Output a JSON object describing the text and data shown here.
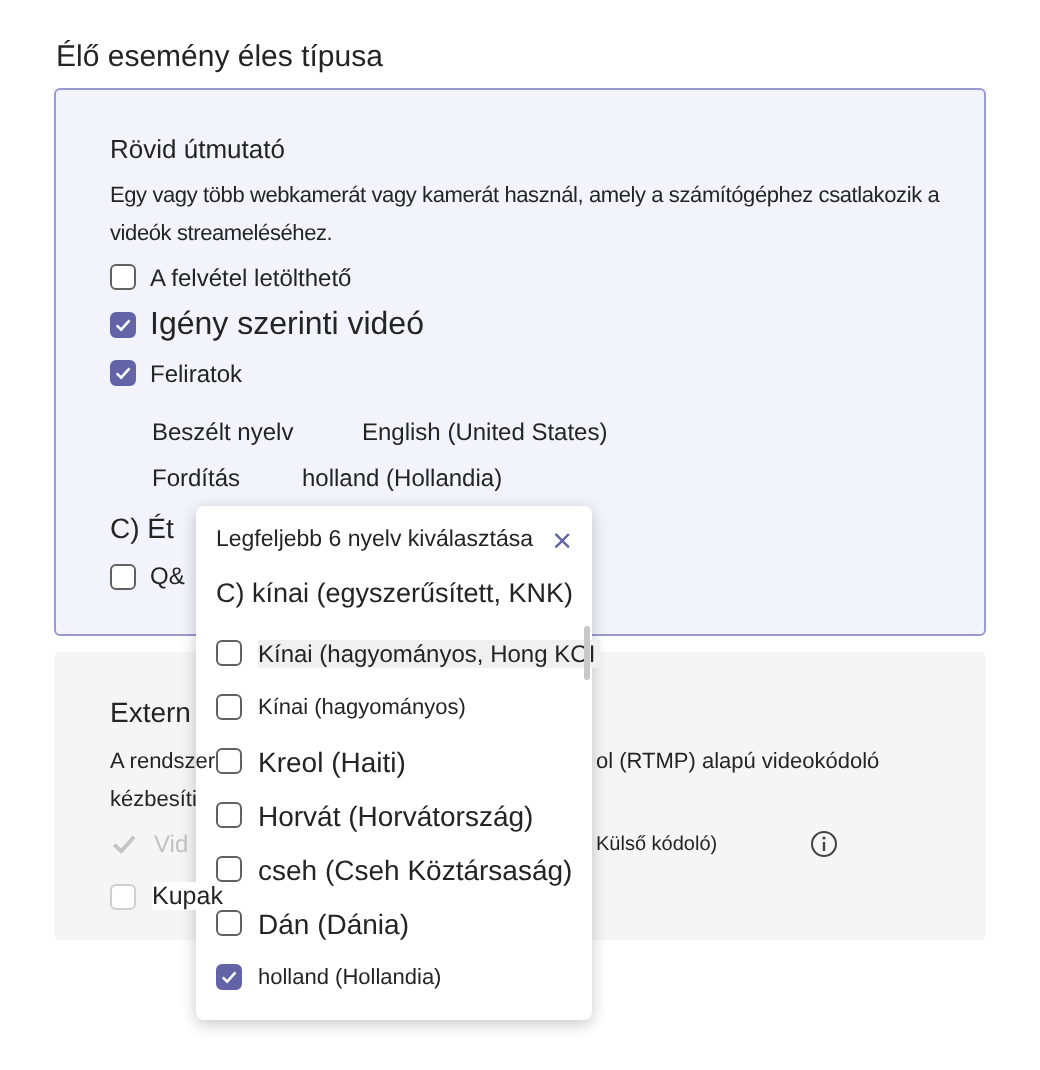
{
  "title": "Élő esemény éles típusa",
  "quick_guide": {
    "heading": "Rövid útmutató",
    "description": "Egy vagy több webkamerát vagy kamerát használ, amely a számítógéphez csatlakozik a videók streameléséhez.",
    "options": [
      {
        "label": "A felvétel letölthető",
        "checked": false
      },
      {
        "label": "Igény szerinti videó",
        "checked": true
      },
      {
        "label": "Feliratok",
        "checked": true
      }
    ],
    "settings": [
      {
        "label": "Beszélt nyelv",
        "value": "English (United States)"
      },
      {
        "label": "Fordítás",
        "value": "holland (Hollandia)"
      }
    ],
    "section_label": "C) Ét",
    "qa": {
      "label": "Q&",
      "checked": false
    }
  },
  "external": {
    "heading": "Extern",
    "description_left": "A rendszer",
    "description_right": "ol (RTMP) alapú videokódoló",
    "description_line2": "kézbesíti",
    "video_label": "Vid",
    "video_right": "Külső kódoló)",
    "captions": {
      "label": "Kupak",
      "checked": false
    }
  },
  "language_popup": {
    "title": "Legfeljebb 6 nyelv kiválasztása",
    "close": "×",
    "top_item": "C) kínai (egyszerűsített, KNK)",
    "items": [
      {
        "label": "Kínai (hagyományos, Hong KOI",
        "checked": false,
        "selected": true
      },
      {
        "label": "Kínai (hagyományos)",
        "checked": false,
        "selected": false
      },
      {
        "label": "Kreol (Haiti)",
        "checked": false,
        "selected": false
      },
      {
        "label": "Horvát (Horvátország)",
        "checked": false,
        "selected": false
      },
      {
        "label": "cseh (Cseh Köztársaság)",
        "checked": false,
        "selected": false
      },
      {
        "label": "Dán (Dánia)",
        "checked": false,
        "selected": false
      },
      {
        "label": "holland (Hollandia)",
        "checked": true,
        "selected": false
      }
    ]
  }
}
